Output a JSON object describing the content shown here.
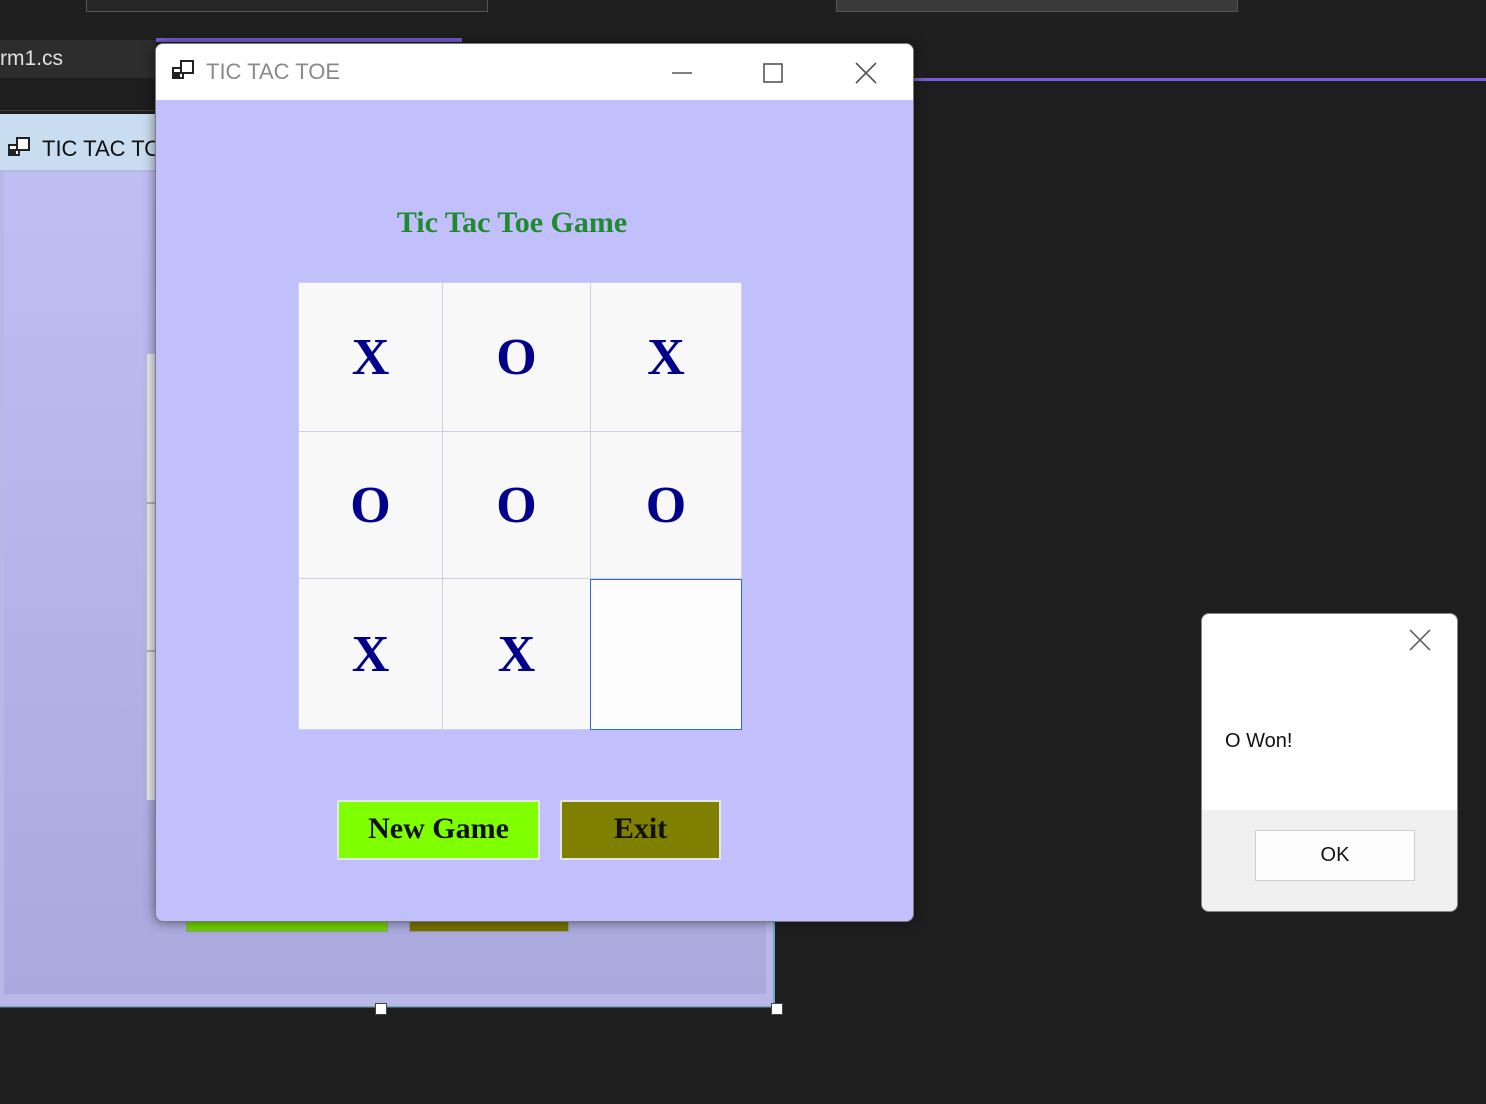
{
  "ide": {
    "tab_label": "rm1.cs",
    "designer_title": "TIC TAC TO"
  },
  "window": {
    "title": "TIC TAC TOE",
    "minimize_glyph": "—",
    "maximize_glyph": "☐",
    "close_glyph": "✕"
  },
  "game": {
    "heading": "Tic Tac Toe Game",
    "board": [
      [
        "X",
        "O",
        "X"
      ],
      [
        "O",
        "O",
        "O"
      ],
      [
        "X",
        "X",
        ""
      ]
    ],
    "new_game_label": "New Game",
    "exit_label": "Exit",
    "colors": {
      "form_bg": "#c2c0fc",
      "heading": "#1f8a2e",
      "mark": "#00008b",
      "new_game_bg": "#80ff00",
      "exit_bg": "#808000"
    }
  },
  "message_box": {
    "text": "O Won!",
    "ok_label": "OK",
    "close_glyph": "✕"
  }
}
